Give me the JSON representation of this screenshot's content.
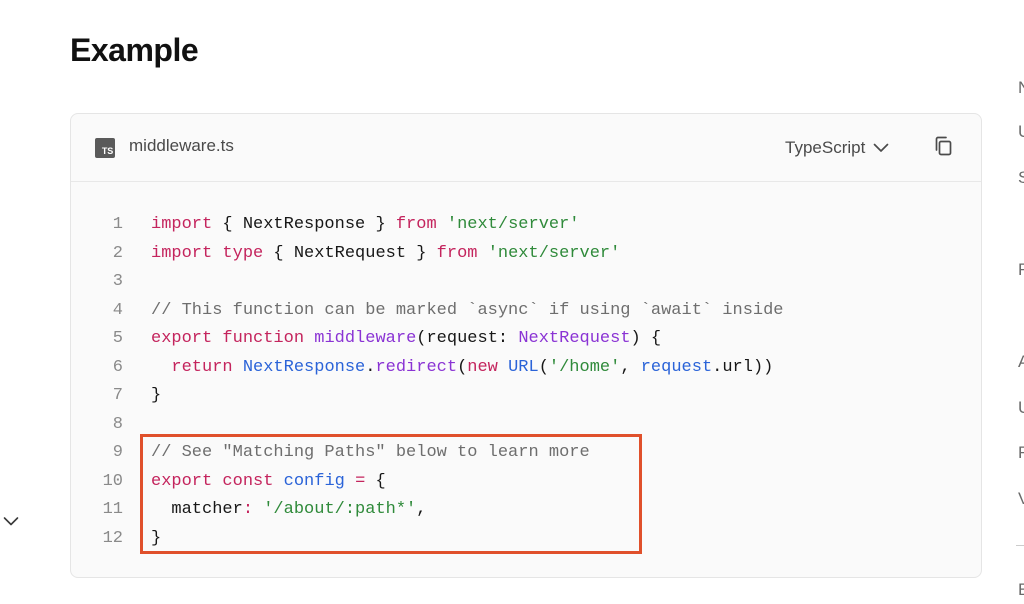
{
  "heading": "Example",
  "code_block": {
    "filename": "middleware.ts",
    "badge": "TS",
    "language": "TypeScript",
    "icons": {
      "file": "typescript-file-icon",
      "dropdown": "chevron-down-icon",
      "copy": "copy-icon"
    },
    "lines": [
      {
        "n": "1",
        "tokens": [
          [
            "kw",
            "import"
          ],
          [
            "p",
            " { NextResponse } "
          ],
          [
            "kw",
            "from"
          ],
          [
            "p",
            " "
          ],
          [
            "str",
            "'next/server'"
          ]
        ]
      },
      {
        "n": "2",
        "tokens": [
          [
            "kw",
            "import"
          ],
          [
            "p",
            " "
          ],
          [
            "kw",
            "type"
          ],
          [
            "p",
            " { NextRequest } "
          ],
          [
            "kw",
            "from"
          ],
          [
            "p",
            " "
          ],
          [
            "str",
            "'next/server'"
          ]
        ]
      },
      {
        "n": "3",
        "tokens": []
      },
      {
        "n": "4",
        "tokens": [
          [
            "cm",
            "// This function can be marked `async` if using `await` inside"
          ]
        ]
      },
      {
        "n": "5",
        "tokens": [
          [
            "kw",
            "export"
          ],
          [
            "p",
            " "
          ],
          [
            "kw",
            "function"
          ],
          [
            "p",
            " "
          ],
          [
            "fn",
            "middleware"
          ],
          [
            "p",
            "(request: "
          ],
          [
            "ty",
            "NextRequest"
          ],
          [
            "p",
            ") {"
          ]
        ]
      },
      {
        "n": "6",
        "tokens": [
          [
            "p",
            "  "
          ],
          [
            "kw",
            "return"
          ],
          [
            "p",
            " "
          ],
          [
            "id",
            "NextResponse"
          ],
          [
            "p",
            "."
          ],
          [
            "fn",
            "redirect"
          ],
          [
            "p",
            "("
          ],
          [
            "kw",
            "new"
          ],
          [
            "p",
            " "
          ],
          [
            "id",
            "URL"
          ],
          [
            "p",
            "("
          ],
          [
            "str",
            "'/home'"
          ],
          [
            "p",
            ", "
          ],
          [
            "id",
            "request"
          ],
          [
            "p",
            ".url))"
          ]
        ]
      },
      {
        "n": "7",
        "tokens": [
          [
            "p",
            "}"
          ]
        ]
      },
      {
        "n": "8",
        "tokens": []
      },
      {
        "n": "9",
        "tokens": [
          [
            "cm",
            "// See \"Matching Paths\" below to learn more"
          ]
        ]
      },
      {
        "n": "10",
        "tokens": [
          [
            "kw",
            "export"
          ],
          [
            "p",
            " "
          ],
          [
            "kw",
            "const"
          ],
          [
            "p",
            " "
          ],
          [
            "id",
            "config"
          ],
          [
            "p",
            " "
          ],
          [
            "kw",
            "="
          ],
          [
            "p",
            " {"
          ]
        ]
      },
      {
        "n": "11",
        "tokens": [
          [
            "p",
            "  matcher"
          ],
          [
            "kw",
            ":"
          ],
          [
            "p",
            " "
          ],
          [
            "str",
            "'/about/:path*'"
          ],
          [
            "p",
            ","
          ]
        ]
      },
      {
        "n": "12",
        "tokens": [
          [
            "p",
            "}"
          ]
        ]
      }
    ],
    "highlighted_lines": [
      "9",
      "12"
    ],
    "highlight_color": "#e0502b"
  },
  "left_toggle_icon": "chevron-down-icon",
  "right_column_letters": [
    "N",
    "U",
    "S",
    "F",
    "A",
    "U",
    "F",
    "V",
    "E"
  ]
}
